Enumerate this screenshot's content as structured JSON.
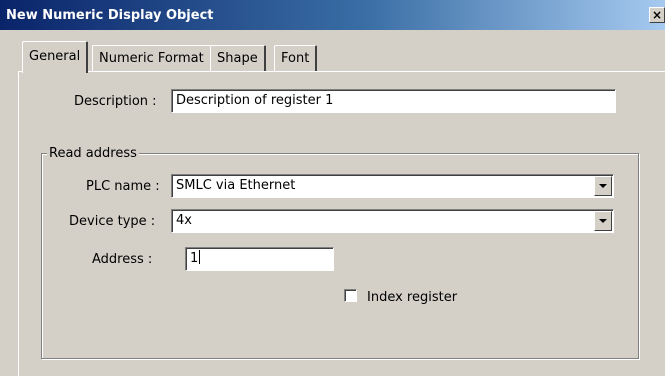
{
  "window": {
    "title": "New Numeric Display Object",
    "close_label": "×"
  },
  "tabs": [
    {
      "label": "General",
      "active": true
    },
    {
      "label": "Numeric Format",
      "active": false
    },
    {
      "label": "Shape",
      "active": false
    },
    {
      "label": "Font",
      "active": false
    }
  ],
  "general": {
    "description_label": "Description :",
    "description_value": "Description of register 1",
    "read_address": {
      "group_label": "Read address",
      "plc_name_label": "PLC name :",
      "plc_name_value": "SMLC via Ethernet",
      "device_type_label": "Device type :",
      "device_type_value": "4x",
      "address_label": "Address :",
      "address_value": "1",
      "index_register_label": "Index register",
      "index_register_checked": false
    }
  }
}
